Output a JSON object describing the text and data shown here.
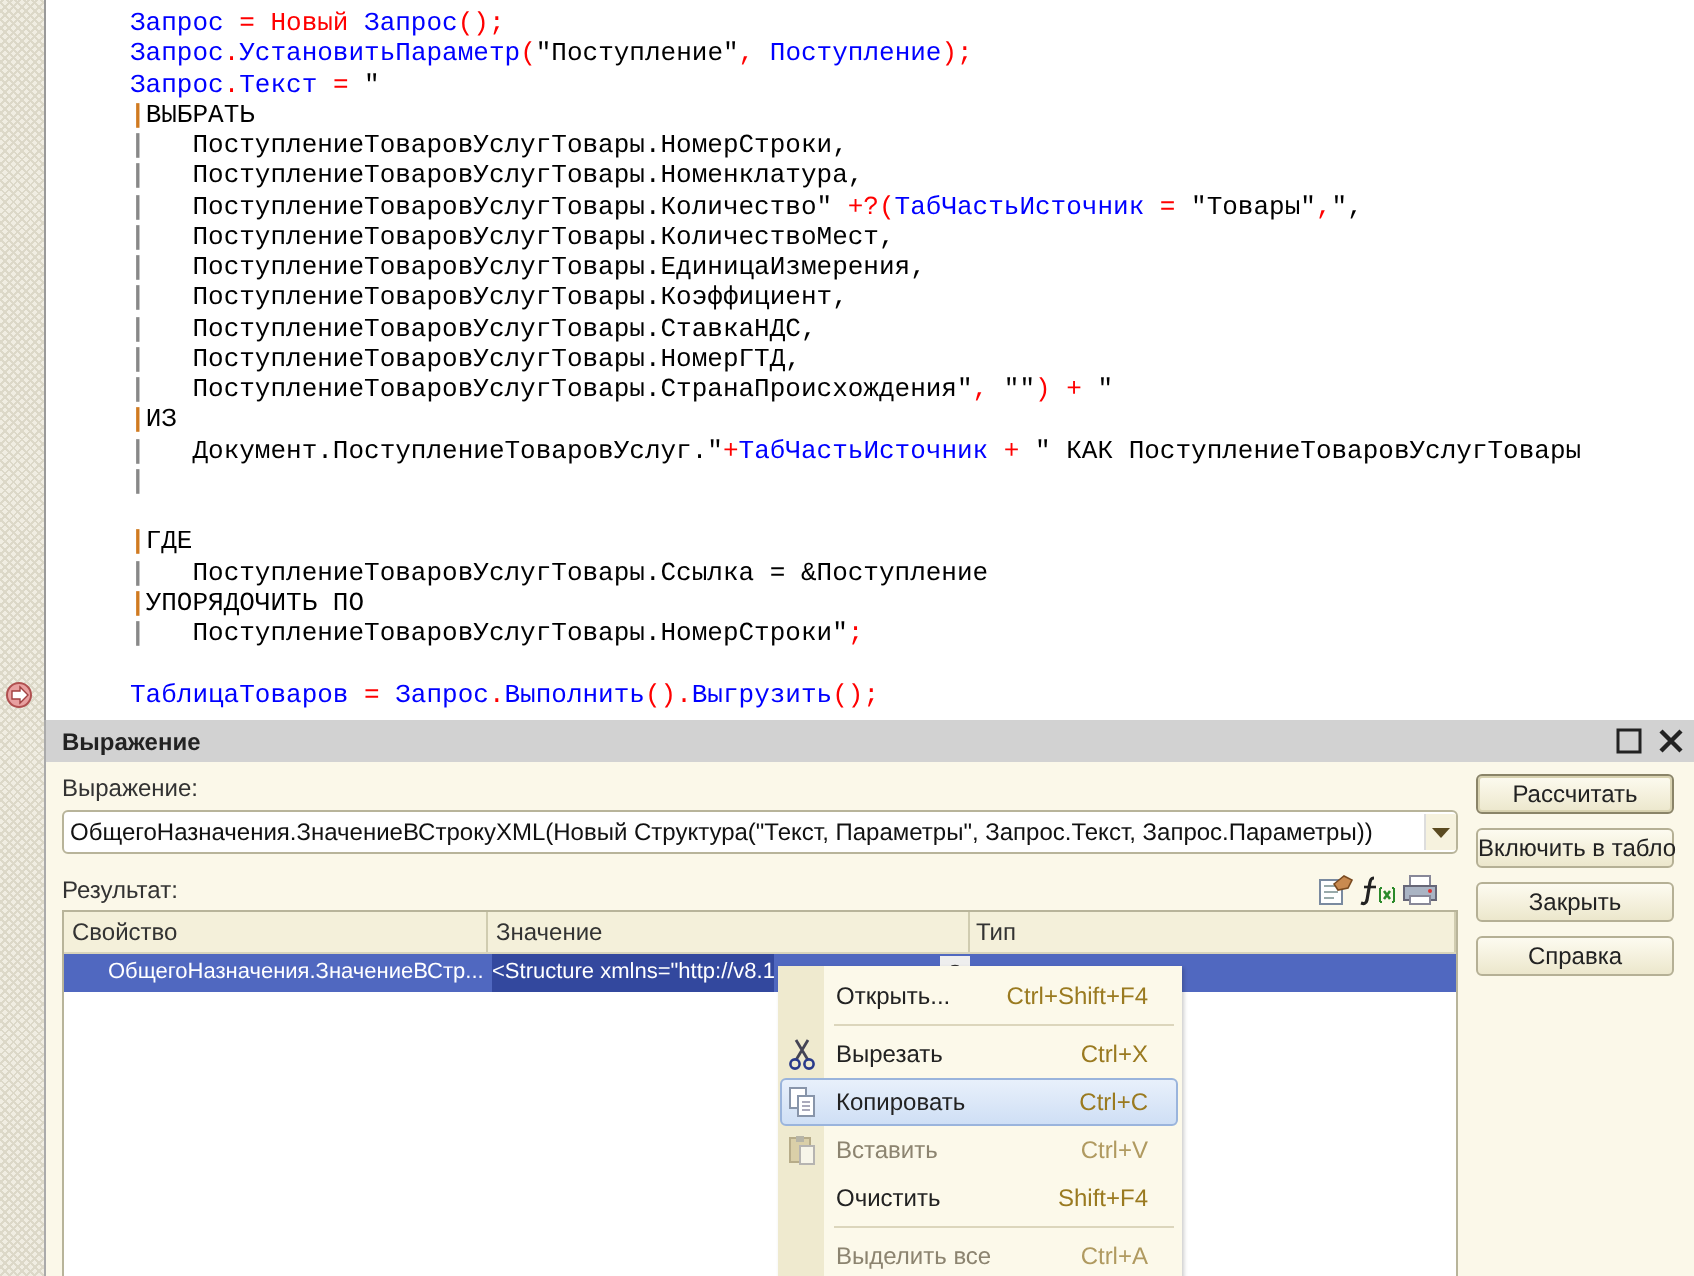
{
  "editor": {
    "lines": [
      {
        "kind": "code",
        "tokens": [
          {
            "kind": "id",
            "t": "Запрос"
          },
          {
            "kind": "op",
            "t": " = Новый "
          },
          {
            "kind": "id",
            "t": "Запрос"
          },
          {
            "kind": "op",
            "t": "();"
          }
        ]
      },
      {
        "kind": "code",
        "tokens": [
          {
            "kind": "id",
            "t": "Запрос"
          },
          {
            "kind": "op",
            "t": "."
          },
          {
            "kind": "id",
            "t": "УстановитьПараметр"
          },
          {
            "kind": "op",
            "t": "("
          },
          {
            "kind": "str",
            "t": "\"Поступление\""
          },
          {
            "kind": "op",
            "t": ", "
          },
          {
            "kind": "id",
            "t": "Поступление"
          },
          {
            "kind": "op",
            "t": ");"
          }
        ]
      },
      {
        "kind": "code",
        "tokens": [
          {
            "kind": "id",
            "t": "Запрос"
          },
          {
            "kind": "op",
            "t": "."
          },
          {
            "kind": "id",
            "t": "Текст"
          },
          {
            "kind": "op",
            "t": " = "
          },
          {
            "kind": "str",
            "t": "\""
          }
        ]
      },
      {
        "kind": "code",
        "tokens": [
          {
            "kind": "mark",
            "t": "|"
          },
          {
            "kind": "str",
            "t": "ВЫБРАТЬ"
          }
        ]
      },
      {
        "kind": "code",
        "tokens": [
          {
            "kind": "pipe",
            "t": "|"
          },
          {
            "kind": "str",
            "t": "   ПоступлениеТоваровУслугТовары.НомерСтроки,"
          }
        ]
      },
      {
        "kind": "code",
        "tokens": [
          {
            "kind": "pipe",
            "t": "|"
          },
          {
            "kind": "str",
            "t": "   ПоступлениеТоваровУслугТовары.Номенклатура,"
          }
        ]
      },
      {
        "kind": "code",
        "tokens": [
          {
            "kind": "pipe",
            "t": "|"
          },
          {
            "kind": "str",
            "t": "   ПоступлениеТоваровУслугТовары.Количество\""
          },
          {
            "kind": "op",
            "t": " +?("
          },
          {
            "kind": "id",
            "t": "ТабЧастьИсточник"
          },
          {
            "kind": "op",
            "t": " = "
          },
          {
            "kind": "str",
            "t": "\"Товары\""
          },
          {
            "kind": "op",
            "t": ","
          },
          {
            "kind": "str",
            "t": "\","
          }
        ]
      },
      {
        "kind": "code",
        "tokens": [
          {
            "kind": "pipe",
            "t": "|"
          },
          {
            "kind": "str",
            "t": "   ПоступлениеТоваровУслугТовары.КоличествоМест,"
          }
        ]
      },
      {
        "kind": "code",
        "tokens": [
          {
            "kind": "pipe",
            "t": "|"
          },
          {
            "kind": "str",
            "t": "   ПоступлениеТоваровУслугТовары.ЕдиницаИзмерения,"
          }
        ]
      },
      {
        "kind": "code",
        "tokens": [
          {
            "kind": "pipe",
            "t": "|"
          },
          {
            "kind": "str",
            "t": "   ПоступлениеТоваровУслугТовары.Коэффициент,"
          }
        ]
      },
      {
        "kind": "code",
        "tokens": [
          {
            "kind": "pipe",
            "t": "|"
          },
          {
            "kind": "str",
            "t": "   ПоступлениеТоваровУслугТовары.СтавкаНДС,"
          }
        ]
      },
      {
        "kind": "code",
        "tokens": [
          {
            "kind": "pipe",
            "t": "|"
          },
          {
            "kind": "str",
            "t": "   ПоступлениеТоваровУслугТовары.НомерГТД,"
          }
        ]
      },
      {
        "kind": "code",
        "tokens": [
          {
            "kind": "pipe",
            "t": "|"
          },
          {
            "kind": "str",
            "t": "   ПоступлениеТоваровУслугТовары.СтранаПроисхождения\""
          },
          {
            "kind": "op",
            "t": ", "
          },
          {
            "kind": "str",
            "t": "\"\""
          },
          {
            "kind": "op",
            "t": ") + "
          },
          {
            "kind": "str",
            "t": "\""
          }
        ]
      },
      {
        "kind": "code",
        "tokens": [
          {
            "kind": "mark",
            "t": "|"
          },
          {
            "kind": "str",
            "t": "ИЗ"
          }
        ]
      },
      {
        "kind": "code",
        "tokens": [
          {
            "kind": "pipe",
            "t": "|"
          },
          {
            "kind": "str",
            "t": "   Документ.ПоступлениеТоваровУслуг.\""
          },
          {
            "kind": "op",
            "t": "+"
          },
          {
            "kind": "id",
            "t": "ТабЧастьИсточник"
          },
          {
            "kind": "op",
            "t": " + "
          },
          {
            "kind": "str",
            "t": "\" КАК ПоступлениеТоваровУслугТовары"
          }
        ]
      },
      {
        "kind": "code",
        "tokens": [
          {
            "kind": "pipe",
            "t": "|"
          }
        ]
      },
      {
        "kind": "blank"
      },
      {
        "kind": "code",
        "tokens": [
          {
            "kind": "mark",
            "t": "|"
          },
          {
            "kind": "str",
            "t": "ГДЕ"
          }
        ]
      },
      {
        "kind": "code",
        "tokens": [
          {
            "kind": "pipe",
            "t": "|"
          },
          {
            "kind": "str",
            "t": "   ПоступлениеТоваровУслугТовары.Ссылка = &Поступление"
          }
        ]
      },
      {
        "kind": "code",
        "tokens": [
          {
            "kind": "mark",
            "t": "|"
          },
          {
            "kind": "str",
            "t": "УПОРЯДОЧИТЬ ПО"
          }
        ]
      },
      {
        "kind": "code",
        "tokens": [
          {
            "kind": "pipe",
            "t": "|"
          },
          {
            "kind": "str",
            "t": "   ПоступлениеТоваровУслугТовары.НомерСтроки\""
          },
          {
            "kind": "op",
            "t": ";"
          }
        ]
      },
      {
        "kind": "blank"
      },
      {
        "kind": "code",
        "current": true,
        "tokens": [
          {
            "kind": "id",
            "t": "ТаблицаТоваров"
          },
          {
            "kind": "op",
            "t": " = "
          },
          {
            "kind": "id",
            "t": "Запрос"
          },
          {
            "kind": "op",
            "t": "."
          },
          {
            "kind": "id",
            "t": "Выполнить"
          },
          {
            "kind": "op",
            "t": "()."
          },
          {
            "kind": "id",
            "t": "Выгрузить"
          },
          {
            "kind": "op",
            "t": "();"
          }
        ]
      }
    ]
  },
  "dialog": {
    "title": "Выражение",
    "expression_label": "Выражение:",
    "expression_value": "ОбщегоНазначения.ЗначениеВСтрокуXML(Новый Структура(\"Текст, Параметры\", Запрос.Текст, Запрос.Параметры))",
    "result_label": "Результат:",
    "table": {
      "columns": [
        "Свойство",
        "Значение",
        "Тип"
      ],
      "rows": [
        {
          "selected": true,
          "cells": [
            "ОбщегоНазначения.ЗначениеВСтр...",
            "<Structure xmlns=\"http://v8.1"
          ]
        }
      ]
    },
    "buttons": [
      {
        "label": "Рассчитать",
        "default": true
      },
      {
        "label": "Включить в табло",
        "default": false
      },
      {
        "label": "Закрыть",
        "default": false
      },
      {
        "label": "Справка",
        "default": false
      }
    ]
  },
  "context_menu": {
    "items": [
      {
        "kind": "item",
        "label": "Открыть...",
        "shortcut": "Ctrl+Shift+F4",
        "selected": false,
        "disabled": false
      },
      {
        "kind": "separator"
      },
      {
        "kind": "item",
        "label": "Вырезать",
        "shortcut": "Ctrl+X",
        "selected": false,
        "disabled": false
      },
      {
        "kind": "item",
        "label": "Копировать",
        "shortcut": "Ctrl+C",
        "selected": true,
        "disabled": false
      },
      {
        "kind": "item",
        "label": "Вставить",
        "shortcut": "Ctrl+V",
        "selected": false,
        "disabled": true
      },
      {
        "kind": "item",
        "label": "Очистить",
        "shortcut": "Shift+F4",
        "selected": false,
        "disabled": false
      },
      {
        "kind": "separator"
      },
      {
        "kind": "item",
        "label": "Выделить все",
        "shortcut": "Ctrl+A",
        "selected": false,
        "disabled": true
      }
    ]
  }
}
